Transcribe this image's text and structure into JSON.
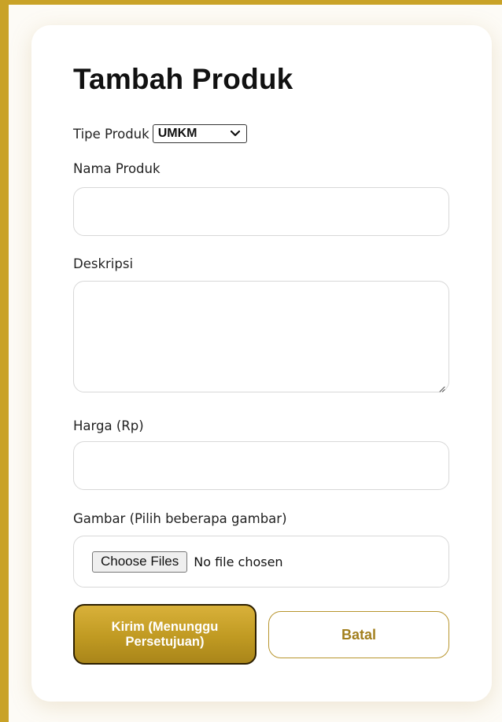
{
  "form": {
    "title": "Tambah Produk",
    "type_label": "Tipe Produk",
    "type_selected": "UMKM",
    "name_label": "Nama Produk",
    "name_value": "",
    "desc_label": "Deskripsi",
    "desc_value": "",
    "price_label": "Harga (Rp)",
    "price_value": "",
    "image_label": "Gambar (Pilih beberapa gambar)",
    "file_button": "Choose Files",
    "file_status": "No file chosen",
    "submit_label": "Kirim (Menunggu Persetujuan)",
    "cancel_label": "Batal"
  },
  "colors": {
    "accent": "#c9a227",
    "cancel_text": "#a27f1d"
  },
  "icons": {
    "select": "chevron-down-icon",
    "textarea": "resize-handle-icon"
  }
}
